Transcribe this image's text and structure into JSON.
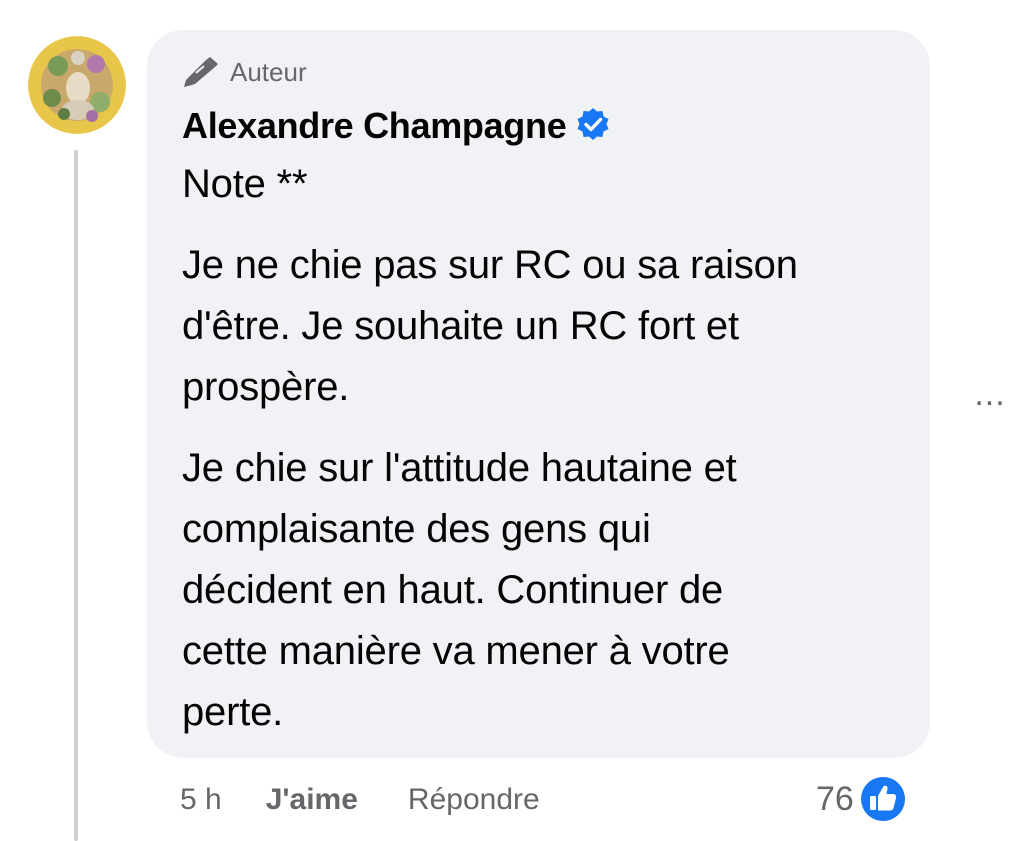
{
  "comment": {
    "author_badge": "Auteur",
    "author_name": "Alexandre Champagne",
    "verified": true,
    "paragraphs": [
      [
        "Note **"
      ],
      [
        "Je ne chie pas sur RC ou sa raison",
        "d'être. Je souhaite un RC fort et",
        "prospère."
      ],
      [
        "Je chie sur l'attitude hautaine et",
        "complaisante des gens qui",
        "décident en haut. Continuer de",
        "cette manière va mener à votre",
        "perte."
      ]
    ],
    "more_label": "..."
  },
  "actions": {
    "time": "5 h",
    "like_label": "J'aime",
    "reply_label": "Répondre"
  },
  "reactions": {
    "count": "76",
    "icon": "like-thumb-icon"
  },
  "colors": {
    "bubble_bg": "#f0f2f5",
    "secondary_text": "#65676b",
    "primary_text": "#050505",
    "accent_blue": "#1877f2"
  }
}
